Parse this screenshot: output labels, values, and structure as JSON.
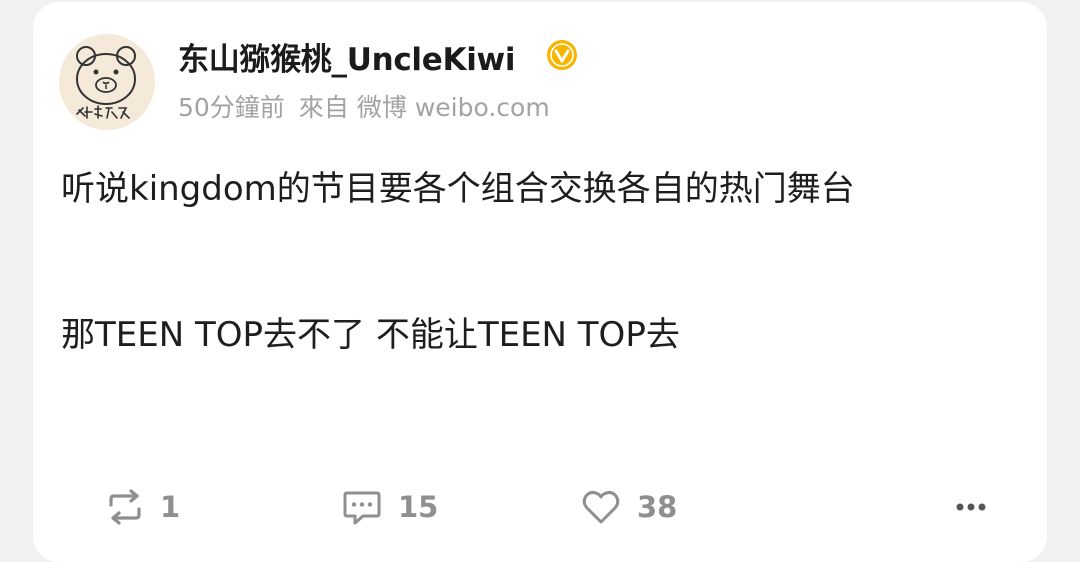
{
  "post": {
    "author": "东山猕猴桃_UncleKiwi",
    "time": "50分鐘前",
    "source_label": "來自",
    "source_app": "微博",
    "source_site": "weibo.com",
    "text_line1": "听说kingdom的节目要各个组合交换各自的热门舞台",
    "text_line2": "那TEEN TOP去不了 不能让TEEN TOP去"
  },
  "avatar": {
    "signature": "抖侯叔叔"
  },
  "actions": {
    "repost_count": "1",
    "comment_count": "15",
    "like_count": "38"
  },
  "icons": {
    "verified": "verified-badge-icon",
    "repost": "repost-icon",
    "comment": "comment-icon",
    "like": "heart-icon",
    "more": "more-dots-icon"
  },
  "colors": {
    "verified_badge": "#f7b500",
    "count_text": "#8f8f8f",
    "meta_text": "#a3a3a3"
  }
}
